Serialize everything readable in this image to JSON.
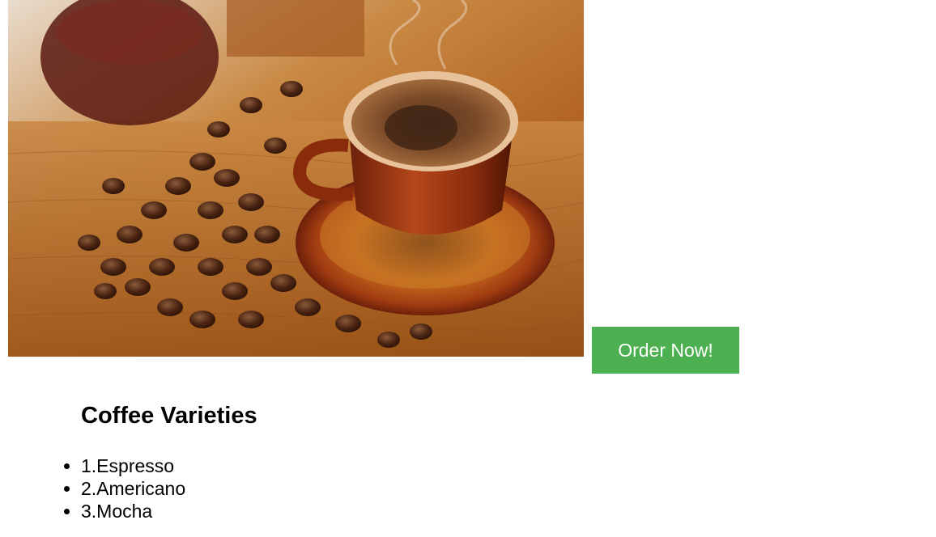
{
  "hero": {
    "image_icon": "coffee-cup-with-beans-photo",
    "order_button_label": "Order Now!",
    "order_button_color": "#4caf50"
  },
  "varieties": {
    "title": "Coffee Varieties",
    "items": [
      "1.Espresso",
      "2.Americano",
      "3.Mocha"
    ]
  }
}
